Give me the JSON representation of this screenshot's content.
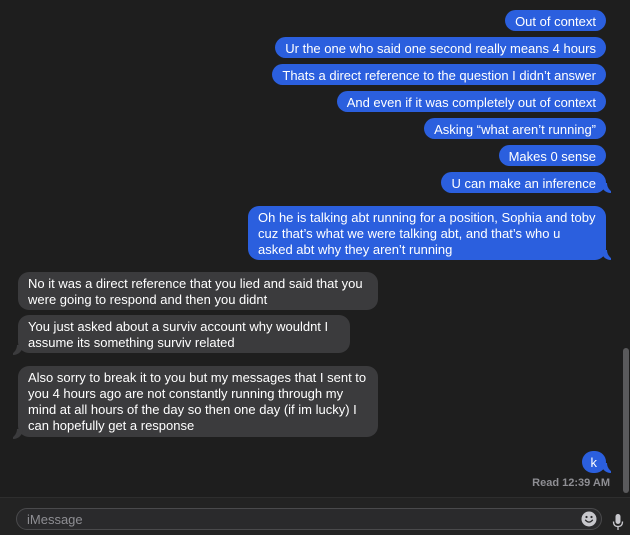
{
  "messages": [
    {
      "from": "me",
      "text": "Out of context"
    },
    {
      "from": "me",
      "text": "Ur the one who said one second really means 4 hours"
    },
    {
      "from": "me",
      "text": "Thats a direct reference to the question I didn’t answer"
    },
    {
      "from": "me",
      "text": "And even if it was completely out of context"
    },
    {
      "from": "me",
      "text": "Asking “what aren’t running”"
    },
    {
      "from": "me",
      "text": "Makes 0 sense"
    },
    {
      "from": "me",
      "text": "U can make an inference"
    },
    {
      "from": "me",
      "text": "Oh he is talking abt running for a position, Sophia and toby cuz that’s what we were talking abt, and that’s who u asked abt why they aren’t running"
    },
    {
      "from": "them",
      "text": "No it was a direct reference that you lied and said that you were going to respond and then you didnt"
    },
    {
      "from": "them",
      "text": "You just asked about a surviv account why wouldnt I assume its something surviv related"
    },
    {
      "from": "them",
      "text": "Also sorry to break it to you but my messages that I sent to you 4 hours ago are not constantly running through my mind at all hours of the day so then one day (if im lucky) I can hopefully get a response"
    },
    {
      "from": "me",
      "text": "k"
    }
  ],
  "read_receipt": "Read 12:39 AM",
  "composer": {
    "placeholder": "iMessage",
    "value": "",
    "emoji_icon": "emoji-face-icon",
    "mic_icon": "microphone-icon"
  },
  "colors": {
    "background": "#1e1e1e",
    "outgoing_bubble": "#2b5fde",
    "incoming_bubble": "#3b3b3d",
    "muted_text": "#8e8e93"
  }
}
